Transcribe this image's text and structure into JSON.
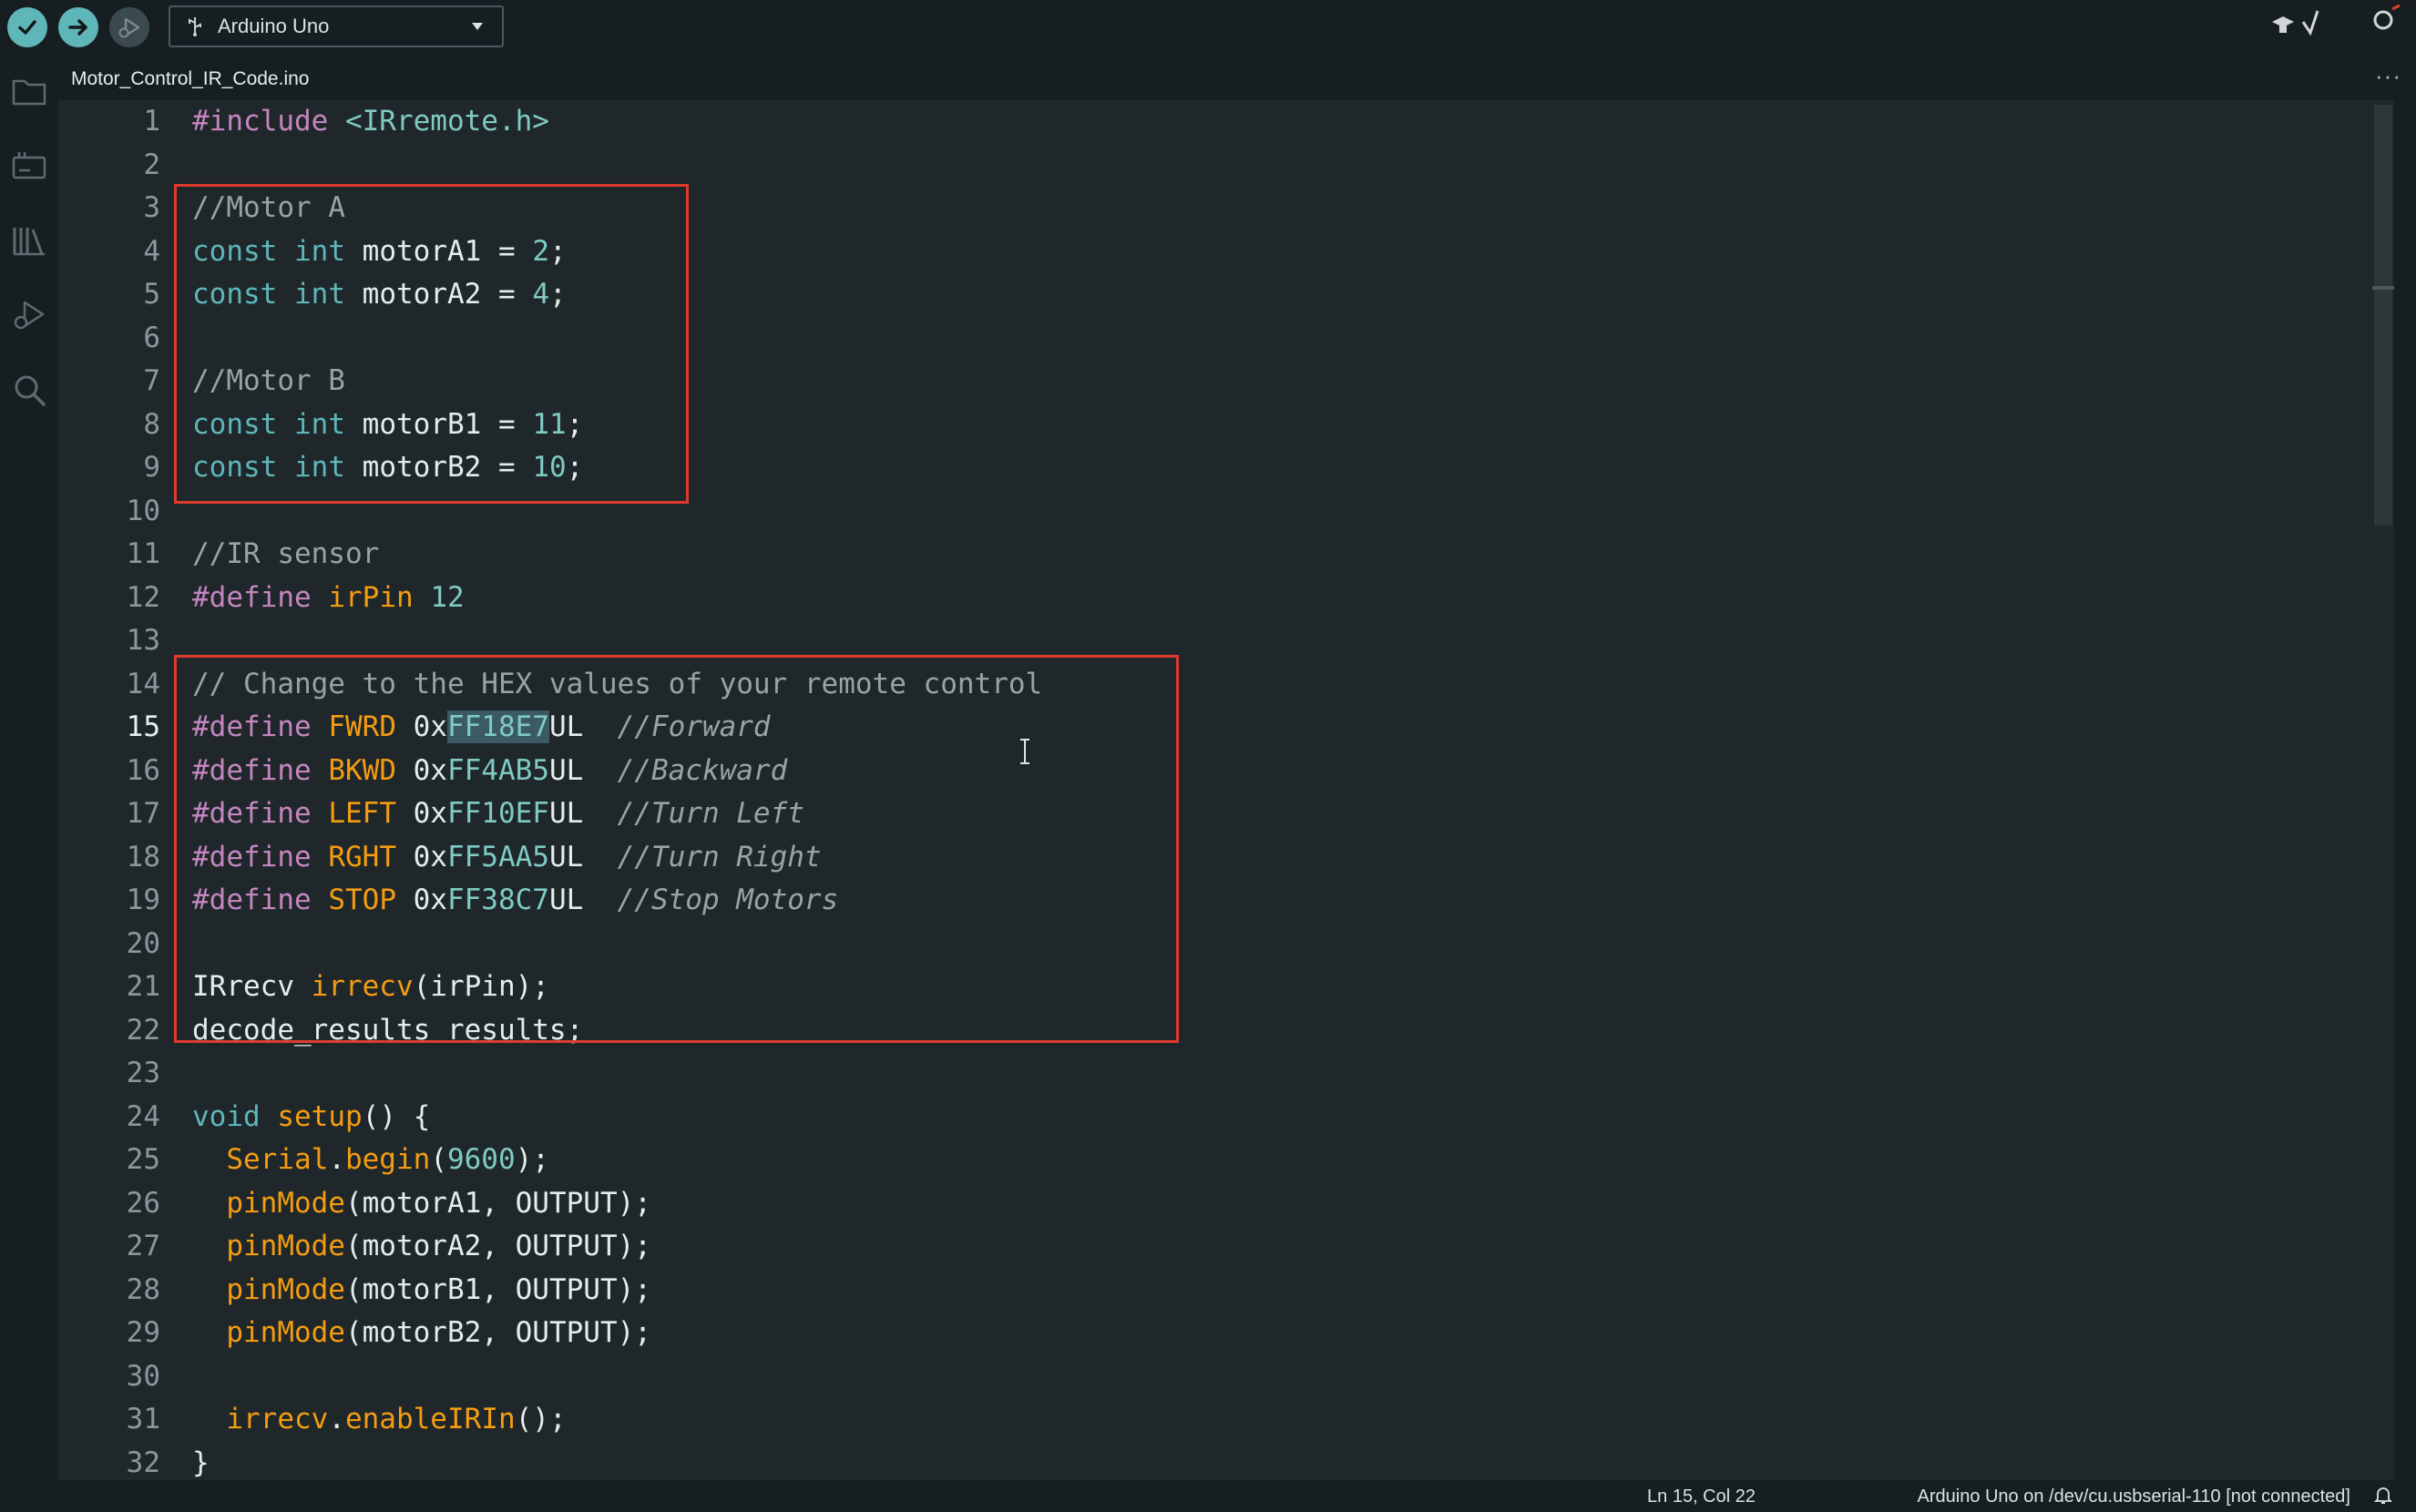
{
  "toolbar": {
    "verify_label": "Verify",
    "upload_label": "Upload",
    "debug_label": "Debug",
    "board_name": "Arduino Uno"
  },
  "tab": {
    "filename": "Motor_Control_IR_Code.ino",
    "more": "···"
  },
  "editor": {
    "active_line": 15,
    "line_numbers": [
      "1",
      "2",
      "3",
      "4",
      "5",
      "6",
      "7",
      "8",
      "9",
      "10",
      "11",
      "12",
      "13",
      "14",
      "15",
      "16",
      "17",
      "18",
      "19",
      "20",
      "21",
      "22",
      "23",
      "24",
      "25",
      "26",
      "27",
      "28",
      "29",
      "30",
      "31",
      "32"
    ],
    "lines": [
      [
        [
          "pre",
          "#include"
        ],
        [
          "plain",
          " "
        ],
        [
          "inc",
          "<IRremote.h>"
        ]
      ],
      [],
      [
        [
          "cmt",
          "//Motor A"
        ]
      ],
      [
        [
          "kw",
          "const"
        ],
        [
          "plain",
          " "
        ],
        [
          "kw",
          "int"
        ],
        [
          "plain",
          " motorA1 = "
        ],
        [
          "num",
          "2"
        ],
        [
          "plain",
          ";"
        ]
      ],
      [
        [
          "kw",
          "const"
        ],
        [
          "plain",
          " "
        ],
        [
          "kw",
          "int"
        ],
        [
          "plain",
          " motorA2 = "
        ],
        [
          "num",
          "4"
        ],
        [
          "plain",
          ";"
        ]
      ],
      [],
      [
        [
          "cmt",
          "//Motor B"
        ]
      ],
      [
        [
          "kw",
          "const"
        ],
        [
          "plain",
          " "
        ],
        [
          "kw",
          "int"
        ],
        [
          "plain",
          " motorB1 = "
        ],
        [
          "num",
          "11"
        ],
        [
          "plain",
          ";"
        ]
      ],
      [
        [
          "kw",
          "const"
        ],
        [
          "plain",
          " "
        ],
        [
          "kw",
          "int"
        ],
        [
          "plain",
          " motorB2 = "
        ],
        [
          "num",
          "10"
        ],
        [
          "plain",
          ";"
        ]
      ],
      [],
      [
        [
          "cmt",
          "//IR sensor"
        ]
      ],
      [
        [
          "pre",
          "#define"
        ],
        [
          "plain",
          " "
        ],
        [
          "macro",
          "irPin"
        ],
        [
          "plain",
          " "
        ],
        [
          "num",
          "12"
        ]
      ],
      [],
      [
        [
          "cmt",
          "// Change to the HEX values of your remote control"
        ]
      ],
      [
        [
          "pre",
          "#define"
        ],
        [
          "plain",
          " "
        ],
        [
          "macro",
          "FWRD"
        ],
        [
          "plain",
          " 0x"
        ],
        [
          "sel",
          "FF18E7"
        ],
        [
          "plain",
          "UL  "
        ],
        [
          "cmt",
          "//Forward"
        ]
      ],
      [
        [
          "pre",
          "#define"
        ],
        [
          "plain",
          " "
        ],
        [
          "macro",
          "BKWD"
        ],
        [
          "plain",
          " 0x"
        ],
        [
          "num",
          "FF4AB5"
        ],
        [
          "plain",
          "UL  "
        ],
        [
          "cmt",
          "//Backward"
        ]
      ],
      [
        [
          "pre",
          "#define"
        ],
        [
          "plain",
          " "
        ],
        [
          "macro",
          "LEFT"
        ],
        [
          "plain",
          " 0x"
        ],
        [
          "num",
          "FF10EF"
        ],
        [
          "plain",
          "UL  "
        ],
        [
          "cmt",
          "//Turn Left"
        ]
      ],
      [
        [
          "pre",
          "#define"
        ],
        [
          "plain",
          " "
        ],
        [
          "macro",
          "RGHT"
        ],
        [
          "plain",
          " 0x"
        ],
        [
          "num",
          "FF5AA5"
        ],
        [
          "plain",
          "UL  "
        ],
        [
          "cmt",
          "//Turn Right"
        ]
      ],
      [
        [
          "pre",
          "#define"
        ],
        [
          "plain",
          " "
        ],
        [
          "macro",
          "STOP"
        ],
        [
          "plain",
          " 0x"
        ],
        [
          "num",
          "FF38C7"
        ],
        [
          "plain",
          "UL  "
        ],
        [
          "cmt",
          "//Stop Motors"
        ]
      ],
      [],
      [
        [
          "plain",
          "IRrecv "
        ],
        [
          "fn",
          "irrecv"
        ],
        [
          "plain",
          "(irPin);"
        ]
      ],
      [
        [
          "plain",
          "decode_results results;"
        ]
      ],
      [],
      [
        [
          "kw",
          "void"
        ],
        [
          "plain",
          " "
        ],
        [
          "fn",
          "setup"
        ],
        [
          "plain",
          "() {"
        ]
      ],
      [
        [
          "plain",
          "  "
        ],
        [
          "fn",
          "Serial"
        ],
        [
          "plain",
          "."
        ],
        [
          "fn",
          "begin"
        ],
        [
          "plain",
          "("
        ],
        [
          "num",
          "9600"
        ],
        [
          "plain",
          ");"
        ]
      ],
      [
        [
          "plain",
          "  "
        ],
        [
          "fn",
          "pinMode"
        ],
        [
          "plain",
          "(motorA1, OUTPUT);"
        ]
      ],
      [
        [
          "plain",
          "  "
        ],
        [
          "fn",
          "pinMode"
        ],
        [
          "plain",
          "(motorA2, OUTPUT);"
        ]
      ],
      [
        [
          "plain",
          "  "
        ],
        [
          "fn",
          "pinMode"
        ],
        [
          "plain",
          "(motorB1, OUTPUT);"
        ]
      ],
      [
        [
          "plain",
          "  "
        ],
        [
          "fn",
          "pinMode"
        ],
        [
          "plain",
          "(motorB2, OUTPUT);"
        ]
      ],
      [],
      [
        [
          "plain",
          "  "
        ],
        [
          "fn",
          "irrecv"
        ],
        [
          "plain",
          "."
        ],
        [
          "fn",
          "enableIRIn"
        ],
        [
          "plain",
          "();"
        ]
      ],
      [
        [
          "plain",
          "}"
        ]
      ]
    ]
  },
  "status": {
    "position": "Ln 15, Col 22",
    "board": "Arduino Uno on /dev/cu.usbserial-110 [not connected]"
  },
  "colors": {
    "accent_teal": "#00878f",
    "highlight_box": "#e03a2f"
  }
}
